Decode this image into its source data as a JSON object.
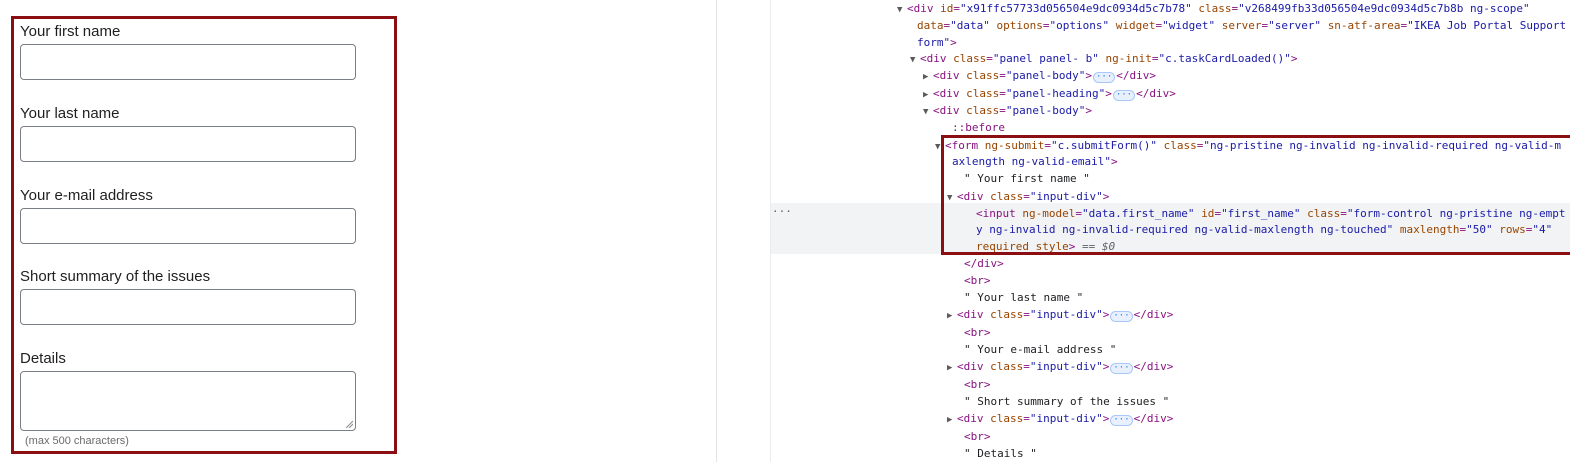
{
  "form": {
    "fields": [
      {
        "label": "Your first name"
      },
      {
        "label": "Your last name"
      },
      {
        "label": "Your e-mail address"
      },
      {
        "label": "Short summary of the issues"
      },
      {
        "label": "Details"
      }
    ],
    "hint": "(max 500 characters)"
  },
  "inspector": {
    "row_menu": "···",
    "ellipsis": "···",
    "lines": [
      {
        "tri": "▼",
        "parts": [
          {
            "c": "tag",
            "t": "<div "
          },
          {
            "c": "attr",
            "t": "id"
          },
          {
            "c": "tag",
            "t": "="
          },
          {
            "c": "val",
            "t": "\"x91ffc57733d056504e9dc0934d5c7b78\""
          },
          {
            "c": "tag",
            "t": " "
          },
          {
            "c": "attr",
            "t": "class"
          },
          {
            "c": "tag",
            "t": "="
          },
          {
            "c": "val",
            "t": "\"v268499fb33d056504e9dc0934d5c7b8b ng-scope\""
          }
        ]
      },
      {
        "parts": [
          {
            "c": "attr",
            "t": "data"
          },
          {
            "c": "tag",
            "t": "="
          },
          {
            "c": "val",
            "t": "\"data\""
          },
          {
            "c": "tag",
            "t": " "
          },
          {
            "c": "attr",
            "t": "options"
          },
          {
            "c": "tag",
            "t": "="
          },
          {
            "c": "val",
            "t": "\"options\""
          },
          {
            "c": "tag",
            "t": " "
          },
          {
            "c": "attr",
            "t": "widget"
          },
          {
            "c": "tag",
            "t": "="
          },
          {
            "c": "val",
            "t": "\"widget\""
          },
          {
            "c": "tag",
            "t": " "
          },
          {
            "c": "attr",
            "t": "server"
          },
          {
            "c": "tag",
            "t": "="
          },
          {
            "c": "val",
            "t": "\"server\""
          },
          {
            "c": "tag",
            "t": " "
          },
          {
            "c": "attr",
            "t": "sn-atf-area"
          },
          {
            "c": "tag",
            "t": "="
          },
          {
            "c": "val",
            "t": "\"IKEA Job Portal Support"
          }
        ]
      },
      {
        "parts": [
          {
            "c": "val",
            "t": "form\""
          },
          {
            "c": "tag",
            "t": ">"
          }
        ]
      },
      {
        "tri": "▼",
        "parts": [
          {
            "c": "tag",
            "t": "<div "
          },
          {
            "c": "attr",
            "t": "class"
          },
          {
            "c": "tag",
            "t": "="
          },
          {
            "c": "val",
            "t": "\"panel panel- b\""
          },
          {
            "c": "tag",
            "t": " "
          },
          {
            "c": "attr",
            "t": "ng-init"
          },
          {
            "c": "tag",
            "t": "="
          },
          {
            "c": "val",
            "t": "\"c.taskCardLoaded()\""
          },
          {
            "c": "tag",
            "t": ">"
          }
        ]
      },
      {
        "tri": "▶",
        "parts": [
          {
            "c": "tag",
            "t": "<div "
          },
          {
            "c": "attr",
            "t": "class"
          },
          {
            "c": "tag",
            "t": "="
          },
          {
            "c": "val",
            "t": "\"panel-body\""
          },
          {
            "c": "tag",
            "t": ">"
          },
          {
            "c": "ell"
          },
          {
            "c": "tag",
            "t": "</div>"
          }
        ]
      },
      {
        "tri": "▶",
        "parts": [
          {
            "c": "tag",
            "t": "<div "
          },
          {
            "c": "attr",
            "t": "class"
          },
          {
            "c": "tag",
            "t": "="
          },
          {
            "c": "val",
            "t": "\"panel-heading\""
          },
          {
            "c": "tag",
            "t": ">"
          },
          {
            "c": "ell"
          },
          {
            "c": "tag",
            "t": "</div>"
          }
        ]
      },
      {
        "tri": "▼",
        "parts": [
          {
            "c": "tag",
            "t": "<div "
          },
          {
            "c": "attr",
            "t": "class"
          },
          {
            "c": "tag",
            "t": "="
          },
          {
            "c": "val",
            "t": "\"panel-body\""
          },
          {
            "c": "tag",
            "t": ">"
          }
        ]
      },
      {
        "parts": [
          {
            "c": "pseudo",
            "t": "::before"
          }
        ]
      },
      {
        "tri": "▼",
        "parts": [
          {
            "c": "tag",
            "t": "<form "
          },
          {
            "c": "attr",
            "t": "ng-submit"
          },
          {
            "c": "tag",
            "t": "="
          },
          {
            "c": "val",
            "t": "\"c.submitForm()\""
          },
          {
            "c": "tag",
            "t": " "
          },
          {
            "c": "attr",
            "t": "class"
          },
          {
            "c": "tag",
            "t": "="
          },
          {
            "c": "val",
            "t": "\"ng-pristine ng-invalid ng-invalid-required ng-valid-m"
          }
        ]
      },
      {
        "parts": [
          {
            "c": "val",
            "t": "axlength ng-valid-email\""
          },
          {
            "c": "tag",
            "t": ">"
          }
        ]
      },
      {
        "parts": [
          {
            "c": "txt",
            "t": "\" Your first name \""
          }
        ]
      },
      {
        "tri": "▼",
        "parts": [
          {
            "c": "tag",
            "t": "<div "
          },
          {
            "c": "attr",
            "t": "class"
          },
          {
            "c": "tag",
            "t": "="
          },
          {
            "c": "val",
            "t": "\"input-div\""
          },
          {
            "c": "tag",
            "t": ">"
          }
        ]
      },
      {
        "parts": [
          {
            "c": "tag",
            "t": "<input "
          },
          {
            "c": "attr",
            "t": "ng-model"
          },
          {
            "c": "tag",
            "t": "="
          },
          {
            "c": "val",
            "t": "\"data.first_name\""
          },
          {
            "c": "tag",
            "t": " "
          },
          {
            "c": "attr",
            "t": "id"
          },
          {
            "c": "tag",
            "t": "="
          },
          {
            "c": "val",
            "t": "\"first_name\""
          },
          {
            "c": "tag",
            "t": " "
          },
          {
            "c": "attr",
            "t": "class"
          },
          {
            "c": "tag",
            "t": "="
          },
          {
            "c": "val",
            "t": "\"form-control ng-pristine ng-empt"
          }
        ]
      },
      {
        "parts": [
          {
            "c": "val",
            "t": "y ng-invalid ng-invalid-required ng-valid-maxlength ng-touched\""
          },
          {
            "c": "tag",
            "t": " "
          },
          {
            "c": "attr",
            "t": "maxlength"
          },
          {
            "c": "tag",
            "t": "="
          },
          {
            "c": "val",
            "t": "\"50\""
          },
          {
            "c": "tag",
            "t": " "
          },
          {
            "c": "attr",
            "t": "rows"
          },
          {
            "c": "tag",
            "t": "="
          },
          {
            "c": "val",
            "t": "\"4\""
          }
        ]
      },
      {
        "parts": [
          {
            "c": "attr",
            "t": "required"
          },
          {
            "c": "tag",
            "t": " "
          },
          {
            "c": "attr",
            "t": "style"
          },
          {
            "c": "tag",
            "t": ">"
          },
          {
            "c": "ref",
            "t": " == $0"
          }
        ]
      },
      {
        "parts": [
          {
            "c": "tag",
            "t": "</div>"
          }
        ]
      },
      {
        "parts": [
          {
            "c": "tag",
            "t": "<br>"
          }
        ]
      },
      {
        "parts": [
          {
            "c": "txt",
            "t": "\" Your last name \""
          }
        ]
      },
      {
        "tri": "▶",
        "parts": [
          {
            "c": "tag",
            "t": "<div "
          },
          {
            "c": "attr",
            "t": "class"
          },
          {
            "c": "tag",
            "t": "="
          },
          {
            "c": "val",
            "t": "\"input-div\""
          },
          {
            "c": "tag",
            "t": ">"
          },
          {
            "c": "ell"
          },
          {
            "c": "tag",
            "t": "</div>"
          }
        ]
      },
      {
        "parts": [
          {
            "c": "tag",
            "t": "<br>"
          }
        ]
      },
      {
        "parts": [
          {
            "c": "txt",
            "t": "\" Your e-mail address \""
          }
        ]
      },
      {
        "tri": "▶",
        "parts": [
          {
            "c": "tag",
            "t": "<div "
          },
          {
            "c": "attr",
            "t": "class"
          },
          {
            "c": "tag",
            "t": "="
          },
          {
            "c": "val",
            "t": "\"input-div\""
          },
          {
            "c": "tag",
            "t": ">"
          },
          {
            "c": "ell"
          },
          {
            "c": "tag",
            "t": "</div>"
          }
        ]
      },
      {
        "parts": [
          {
            "c": "tag",
            "t": "<br>"
          }
        ]
      },
      {
        "parts": [
          {
            "c": "txt",
            "t": "\" Short summary of the issues \""
          }
        ]
      },
      {
        "tri": "▶",
        "parts": [
          {
            "c": "tag",
            "t": "<div "
          },
          {
            "c": "attr",
            "t": "class"
          },
          {
            "c": "tag",
            "t": "="
          },
          {
            "c": "val",
            "t": "\"input-div\""
          },
          {
            "c": "tag",
            "t": ">"
          },
          {
            "c": "ell"
          },
          {
            "c": "tag",
            "t": "</div>"
          }
        ]
      },
      {
        "parts": [
          {
            "c": "tag",
            "t": "<br>"
          }
        ]
      },
      {
        "parts": [
          {
            "c": "txt",
            "t": "\" Details \""
          }
        ]
      }
    ]
  }
}
